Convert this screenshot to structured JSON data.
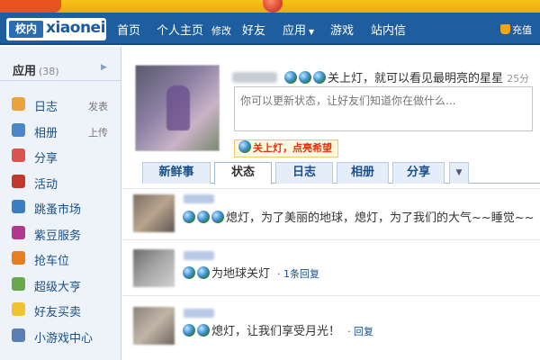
{
  "banner": {
    "promo_left": "",
    "promo_right": ""
  },
  "nav": {
    "logo_tag": "校内",
    "logo_word": "xiaonei",
    "home": "首页",
    "profile": "个人主页",
    "edit": "修改",
    "friends": "好友",
    "apps": "应用",
    "apps_arrow": "▼",
    "games": "游戏",
    "inbox": "站内信",
    "charge": "充值"
  },
  "sidebar": {
    "title": "应用",
    "count": "(38)",
    "arrow": "▶",
    "items": [
      {
        "label": "日志",
        "action": "发表",
        "icon": "diary-icon",
        "color": "#e8a33a"
      },
      {
        "label": "相册",
        "action": "上传",
        "icon": "photo-album-icon",
        "color": "#4a86c8"
      },
      {
        "label": "分享",
        "action": "",
        "icon": "share-icon",
        "color": "#d9534f"
      },
      {
        "label": "活动",
        "action": "",
        "icon": "calendar-icon",
        "color": "#c0392b"
      },
      {
        "label": "跳蚤市场",
        "action": "",
        "icon": "cart-icon",
        "color": "#3a7fc4"
      },
      {
        "label": "紫豆服务",
        "action": "",
        "icon": "purple-bean-icon",
        "color": "#b0388f"
      },
      {
        "label": "抢车位",
        "action": "",
        "icon": "parking-icon",
        "color": "#e67e22"
      },
      {
        "label": "超级大亨",
        "action": "",
        "icon": "tycoon-icon",
        "color": "#6aa84f"
      },
      {
        "label": "好友买卖",
        "action": "",
        "icon": "friend-trade-icon",
        "color": "#f1c232"
      },
      {
        "label": "小游戏中心",
        "action": "",
        "icon": "gamepad-icon",
        "color": "#5b7fb5"
      }
    ]
  },
  "profile": {
    "status_text": "关上灯，就可以看见最明亮的星星",
    "status_time": "25分",
    "status_placeholder": "你可以更新状态，让好友们知道你在做什么...",
    "light_button": "关上灯，点亮希望"
  },
  "tabs": [
    "新鲜事",
    "状态",
    "日志",
    "相册",
    "分享"
  ],
  "tab_more": "▼",
  "feed": [
    {
      "text": "熄灯，为了美丽的地球，熄灯，为了我们的大气~~睡觉~~",
      "reply": ""
    },
    {
      "text": "为地球关灯",
      "reply": "1条回复"
    },
    {
      "text": "熄灯，让我们享受月光！",
      "reply": "回复"
    }
  ]
}
